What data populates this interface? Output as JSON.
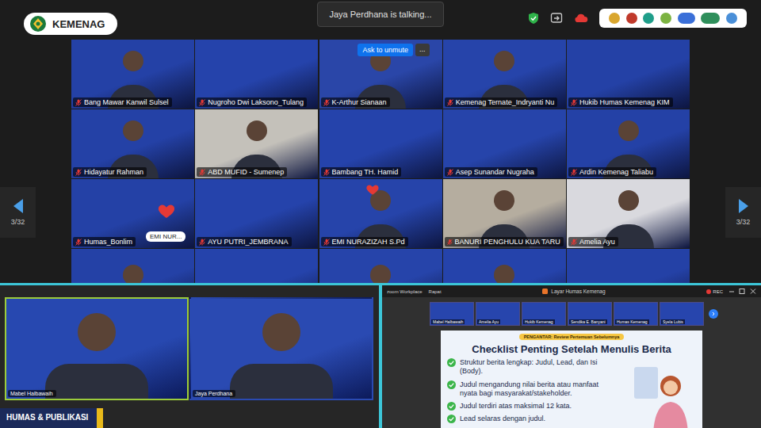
{
  "header": {
    "org": "KEMENAG",
    "speaking": "Jaya Perdhana is talking..."
  },
  "pager": {
    "left": "3/32",
    "right": "3/32"
  },
  "gallery": [
    {
      "name": "Bang Mawar Kanwil Sulsel",
      "muted": true,
      "video": true,
      "color": "#2441a6"
    },
    {
      "name": "Nugroho Dwi Laksono_Tulang",
      "muted": true,
      "video": false,
      "color": "#2543ab"
    },
    {
      "name": "K-Arthur Sianaan",
      "muted": true,
      "video": true,
      "color": "#2a46a8",
      "overlay": {
        "button": "Ask to unmute",
        "more": "..."
      }
    },
    {
      "name": "Kemenag Ternate_Indryanti Nu",
      "muted": true,
      "video": true,
      "color": "#2644aa"
    },
    {
      "name": "Hukib Humas Kemenag KIM",
      "muted": true,
      "video": false,
      "color": "#2441a6"
    },
    {
      "name": "Hidayatur Rahman",
      "muted": true,
      "video": true,
      "color": "#2441a6"
    },
    {
      "name": "ABD MUFID - Sumenep",
      "muted": true,
      "video": true,
      "color": "#c4c1ba"
    },
    {
      "name": "Bambang TH. Hamid",
      "muted": true,
      "video": false,
      "color": "#2543ab"
    },
    {
      "name": "Asep Sunandar Nugraha",
      "muted": true,
      "video": false,
      "color": "#2644aa"
    },
    {
      "name": "Ardin Kemenag Taliabu",
      "muted": true,
      "video": true,
      "color": "#2441a6"
    },
    {
      "name": "Humas_Bonlim",
      "muted": true,
      "video": false,
      "color": "#2441a6",
      "reaction": {
        "heart": true,
        "sender": "EMI NUR..."
      }
    },
    {
      "name": "AYU PUTRI_JEMBRANA",
      "muted": true,
      "video": false,
      "color": "#2543ab"
    },
    {
      "name": "EMI NURAZIZAH S.Pd",
      "muted": true,
      "video": true,
      "color": "#2644aa",
      "reaction": {
        "heart": true,
        "sender": ""
      }
    },
    {
      "name": "BANURI PENGHULU KUA TARU",
      "muted": true,
      "video": true,
      "color": "#b5ad9f"
    },
    {
      "name": "Amelia Ayu",
      "muted": true,
      "video": true,
      "color": "#d9d9de"
    }
  ],
  "partial_row": [
    {
      "video": true,
      "color": "#2441a6"
    },
    {
      "video": false,
      "color": "#2543ab"
    },
    {
      "video": true,
      "color": "#2644aa"
    },
    {
      "video": true,
      "color": "#2543ab"
    },
    {
      "video": false,
      "color": "#2441a6"
    }
  ],
  "speakers": [
    {
      "name": "Mabel Halbawaih",
      "active": true,
      "color": "#2748b0"
    },
    {
      "name": "Jaya Perdhana",
      "active": false,
      "color": "#2a4ab2"
    }
  ],
  "banner": "HUMAS & PUBLIKASI",
  "shared_screen": {
    "app": "zoom Workplace",
    "meeting": "Rapat",
    "title": "Layar Humas Kemenag",
    "rec": "REC",
    "thumbnails": [
      "Mabel Halbawaih",
      "Amelia Ayu",
      "Hukib Kemenag",
      "Sendika E. Banyani",
      "Humas Kemenag",
      "Syela Lubis"
    ],
    "slide": {
      "tag": "PENGANTAR: Review Pertemuan Sebelumnya",
      "title": "Checklist Penting Setelah Menulis Berita",
      "items": [
        "Struktur berita lengkap: Judul, Lead, dan Isi (Body).",
        "Judul mengandung nilai berita atau manfaat nyata bagi masyarakat/stakeholder.",
        "Judul terdiri atas maksimal 12 kata.",
        "Lead selaras dengan judul."
      ]
    }
  }
}
